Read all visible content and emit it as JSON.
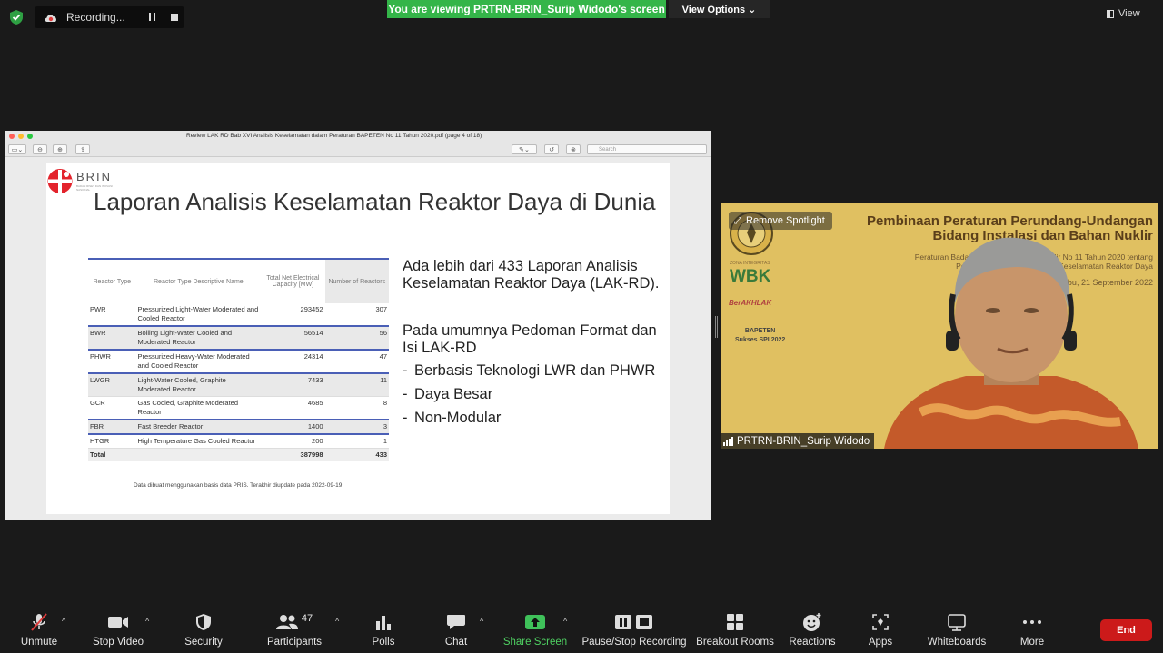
{
  "topbar": {
    "recording_label": "Recording...",
    "viewing_banner": "You are viewing PRTRN-BRIN_Surip Widodo's screen",
    "view_options_label": "View Options ⌄",
    "view_label": "View"
  },
  "pdf": {
    "window_title": "Review LAK RD Bab XVI Analisis Keselamatan dalam Peraturan BAPETEN No 11 Tahun 2020.pdf (page 4 of 18)",
    "search_placeholder": "Search"
  },
  "slide": {
    "logo_text": "BRIN",
    "logo_subtext": "BADAN RISET DAN INOVASI NASIONAL",
    "title": "Laporan Analisis Keselamatan Reaktor Daya di Dunia",
    "table": {
      "headers": [
        "Reactor Type",
        "Reactor Type Descriptive Name",
        "Total Net Electrical Capacity [MW]",
        "Number of Reactors"
      ],
      "rows": [
        {
          "type": "PWR",
          "name": "Pressurized Light-Water Moderated and Cooled Reactor",
          "capacity": "293452",
          "count": "307"
        },
        {
          "type": "BWR",
          "name": "Boiling Light-Water Cooled and Moderated Reactor",
          "capacity": "56514",
          "count": "56"
        },
        {
          "type": "PHWR",
          "name": "Pressurized Heavy-Water Moderated and Cooled Reactor",
          "capacity": "24314",
          "count": "47"
        },
        {
          "type": "LWGR",
          "name": "Light-Water Cooled, Graphite Moderated Reactor",
          "capacity": "7433",
          "count": "11"
        },
        {
          "type": "GCR",
          "name": "Gas Cooled, Graphite Moderated Reactor",
          "capacity": "4685",
          "count": "8"
        },
        {
          "type": "FBR",
          "name": "Fast Breeder Reactor",
          "capacity": "1400",
          "count": "3"
        },
        {
          "type": "HTGR",
          "name": "High Temperature Gas Cooled Reactor",
          "capacity": "200",
          "count": "1"
        }
      ],
      "total": {
        "label": "Total",
        "capacity": "387998",
        "count": "433"
      }
    },
    "source_note": "Data dibuat menggunakan basis data PRIS. Terakhir diupdate pada 2022-09-19",
    "para1": "Ada lebih dari 433 Laporan Analisis Keselamatan Reaktor Daya (LAK-RD).",
    "para2": "Pada umumnya Pedoman Format dan Isi LAK-RD",
    "bullets": [
      "Berbasis Teknologi LWR dan PHWR",
      "Daya Besar",
      "Non-Modular"
    ]
  },
  "video": {
    "remove_spotlight": "Remove Spotlight",
    "bg_heading_1": "Pembinaan Peraturan Perundang-Undangan",
    "bg_heading_2": "Bidang Instalasi dan Bahan Nuklir",
    "bg_sub_1": "Peraturan Badan Pengawas Tenaga Nuklir No 11 Tahun 2020 tentang",
    "bg_sub_2": "Persyaratan Laporan Analisis Keselamatan Reaktor Daya",
    "bg_date": "Rabu, 21 September 2022",
    "wbk_small": "ZONA INTEGRITAS",
    "wbk": "WBK",
    "berakhlak": "BerAKHLAK",
    "bapeten_1": "BAPETEN",
    "bapeten_2": "Sukses SPI 2022",
    "participant_name": "PRTRN-BRIN_Surip Widodo"
  },
  "toolbar": {
    "unmute": "Unmute",
    "stop_video": "Stop Video",
    "security": "Security",
    "participants": "Participants",
    "participants_count": "47",
    "polls": "Polls",
    "chat": "Chat",
    "share_screen": "Share Screen",
    "pause_recording": "Pause/Stop Recording",
    "breakout_rooms": "Breakout Rooms",
    "reactions": "Reactions",
    "apps": "Apps",
    "whiteboards": "Whiteboards",
    "more": "More",
    "end": "End"
  },
  "colors": {
    "banner_green": "#34b549",
    "end_red": "#cc1a1a",
    "table_rule_blue": "#4a5fb6"
  }
}
